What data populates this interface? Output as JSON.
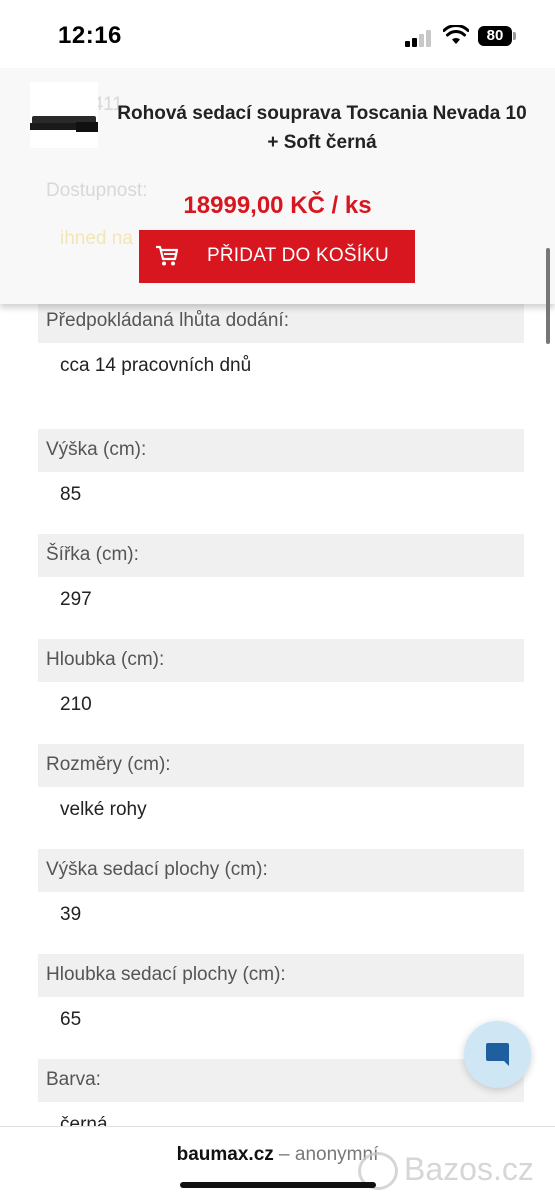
{
  "status_bar": {
    "time": "12:16",
    "battery": "80"
  },
  "header": {
    "ghost_code": "4411",
    "ghost_label": "Dostupnost:",
    "ghost_value": "ihned na",
    "product_title": "Rohová sedací souprava Toscania Nevada 10 + Soft černá",
    "price": "18999,00 KČ / ks",
    "add_to_cart": "PŘIDAT DO KOŠÍKU",
    "accent_color": "#d8161f"
  },
  "specs": [
    {
      "label": "Předpokládaná lhůta dodání:",
      "value": "cca 14 pracovních dnů"
    },
    {
      "label": "Výška (cm):",
      "value": "85"
    },
    {
      "label": "Šířka (cm):",
      "value": "297"
    },
    {
      "label": "Hloubka (cm):",
      "value": "210"
    },
    {
      "label": "Rozměry (cm):",
      "value": "velké rohy"
    },
    {
      "label": "Výška sedací plochy (cm):",
      "value": "39"
    },
    {
      "label": "Hloubka sedací plochy (cm):",
      "value": "65"
    },
    {
      "label": "Barva:",
      "value": "černá"
    }
  ],
  "bottom_bar": {
    "domain": "baumax.cz",
    "suffix": " – anonymní"
  },
  "watermark": "Bazos.cz"
}
